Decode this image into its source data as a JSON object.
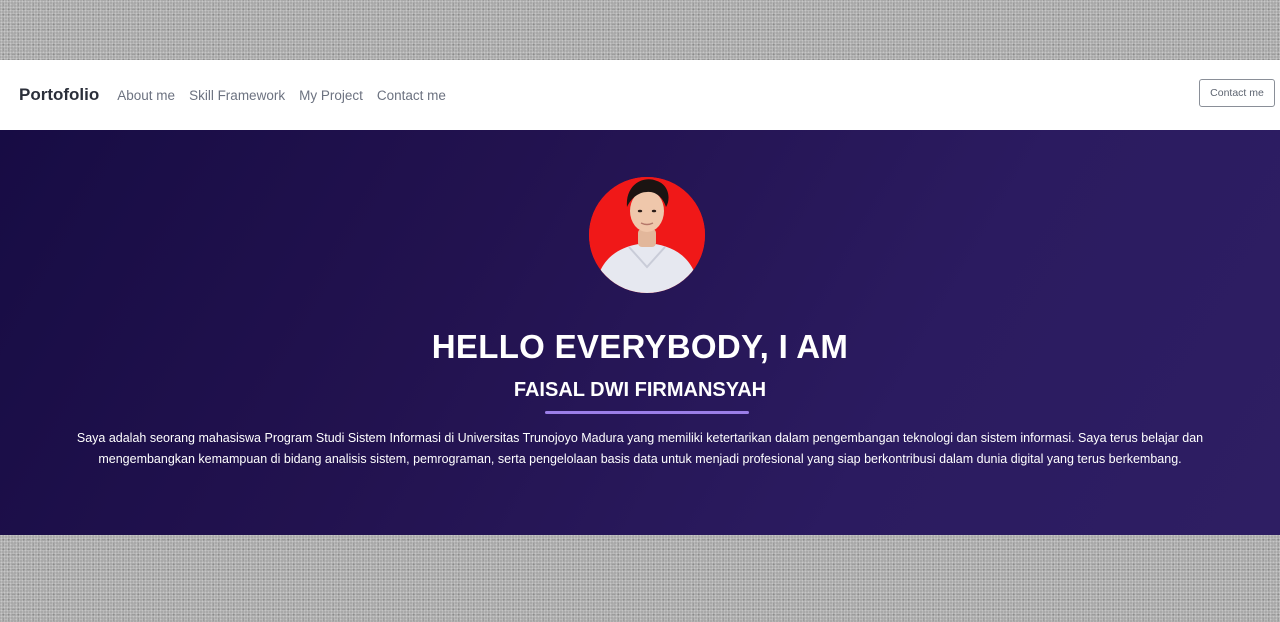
{
  "navbar": {
    "brand": "Portofolio",
    "links": [
      {
        "label": "About me"
      },
      {
        "label": "Skill Framework"
      },
      {
        "label": "My Project"
      },
      {
        "label": "Contact me"
      }
    ],
    "cta_label": "Contact me"
  },
  "hero": {
    "title": "HELLO EVERYBODY, I AM",
    "name": "FAISAL DWI FIRMANSYAH",
    "description": "Saya adalah seorang mahasiswa Program Studi Sistem Informasi di Universitas Trunojoyo Madura yang memiliki ketertarikan dalam pengembangan teknologi dan sistem informasi. Saya terus belajar dan mengembangkan kemampuan di bidang analisis sistem, pemrograman, serta pengelolaan basis data untuk menjadi profesional yang siap berkontribusi dalam dunia digital yang terus berkembang."
  },
  "colors": {
    "navbar_bg": "#ffffff",
    "hero_gradient_start": "#170c44",
    "hero_gradient_end": "#2e1e63",
    "divider_accent": "#9b7ee8",
    "avatar_bg": "#f01818"
  },
  "icons": {
    "avatar": "profile-photo"
  }
}
